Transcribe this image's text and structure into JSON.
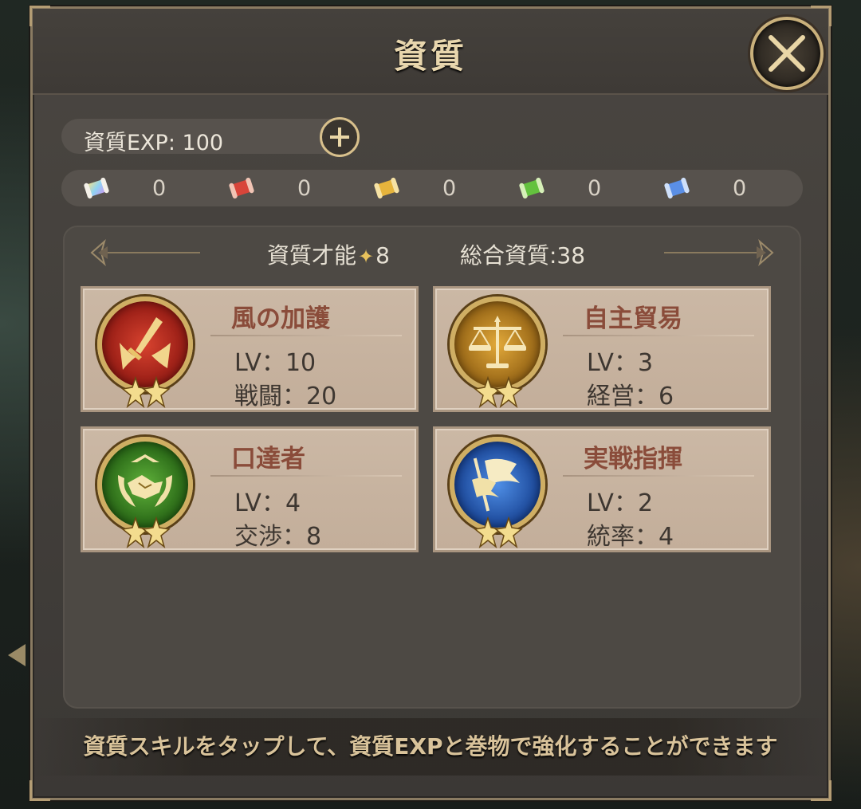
{
  "dialog": {
    "title": "資質",
    "close_icon": "close-x-icon"
  },
  "exp": {
    "label": "資質EXP: 100",
    "add_icon": "plus-icon"
  },
  "scrolls": [
    {
      "icon": "rainbow-scroll-icon",
      "count": "0",
      "color": "#9fd0f0"
    },
    {
      "icon": "red-scroll-icon",
      "count": "0",
      "color": "#d8453a"
    },
    {
      "icon": "gold-scroll-icon",
      "count": "0",
      "color": "#e6b43c"
    },
    {
      "icon": "green-scroll-icon",
      "count": "0",
      "color": "#64c23e"
    },
    {
      "icon": "blue-scroll-icon",
      "count": "0",
      "color": "#5a8fe6"
    }
  ],
  "summary": {
    "talent_label": "資質才能",
    "talent_value": "8",
    "total": "総合資質:38"
  },
  "skills": [
    {
      "name": "風の加護",
      "lv": "LV：10",
      "stat": "戦闘：20",
      "icon": "sword-wings-icon",
      "color": "#b8231b",
      "stars": 2
    },
    {
      "name": "自主貿易",
      "lv": "LV：3",
      "stat": "経営：6",
      "icon": "scales-icon",
      "color": "#c18a1c",
      "stars": 2
    },
    {
      "name": "口達者",
      "lv": "LV：4",
      "stat": "交渉：8",
      "icon": "handshake-icon",
      "color": "#3f8f26",
      "stars": 2
    },
    {
      "name": "実戦指揮",
      "lv": "LV：2",
      "stat": "統率：4",
      "icon": "flag-icon",
      "color": "#2d6fc8",
      "stars": 2
    }
  ],
  "hint": "資質スキルをタップして、資質EXPと巻物で強化することができます",
  "colors": {
    "accent_gold": "#d8c08c",
    "title": "#e8d6ad",
    "skill_name": "#8a4c3a"
  }
}
